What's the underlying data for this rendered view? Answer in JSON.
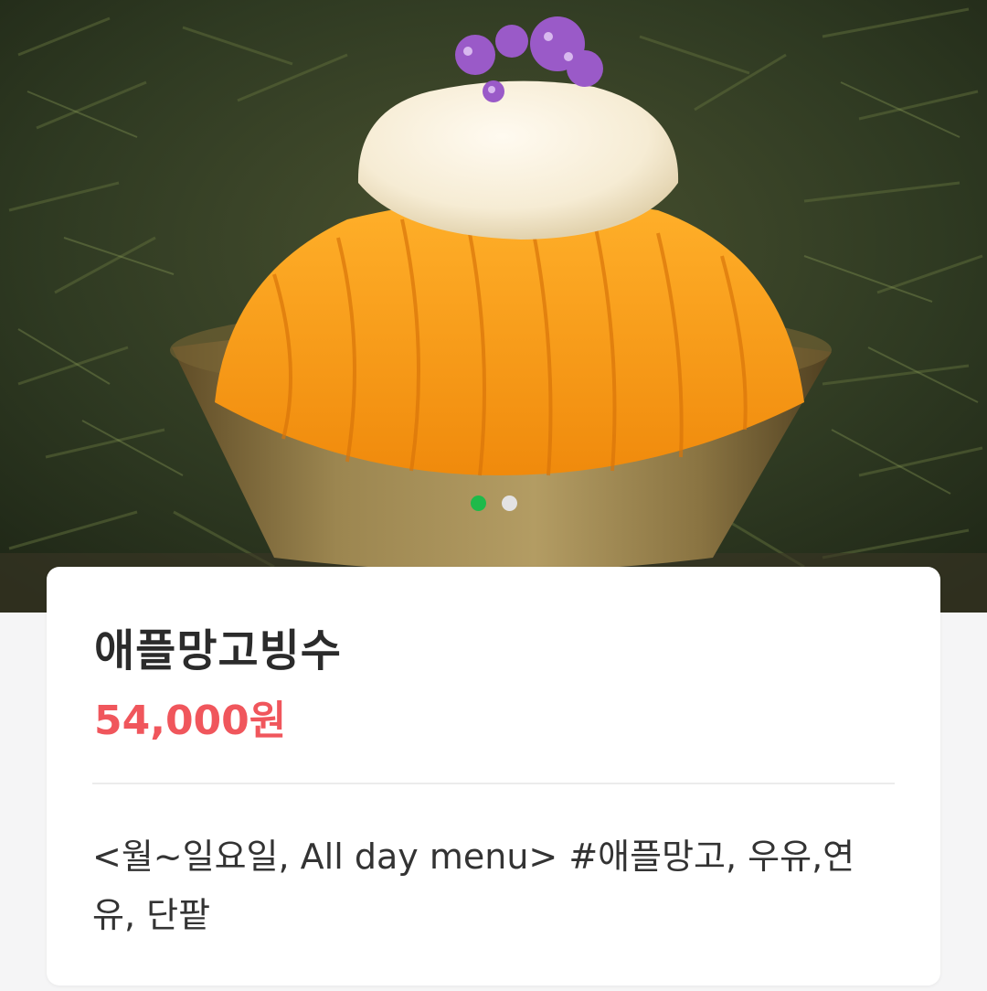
{
  "carousel": {
    "image_alt": "애플망고빙수",
    "slide_count": 2,
    "active_index": 0,
    "colors": {
      "active": "#1fba4a",
      "inactive": "#e6e6ea"
    }
  },
  "menu_item": {
    "name": "애플망고빙수",
    "price": "54,000원",
    "description": "<월~일요일, All day menu> #애플망고, 우유,연유, 단팥"
  },
  "colors": {
    "price": "#f0565c",
    "title": "#2b2b2b",
    "description": "#333333"
  }
}
